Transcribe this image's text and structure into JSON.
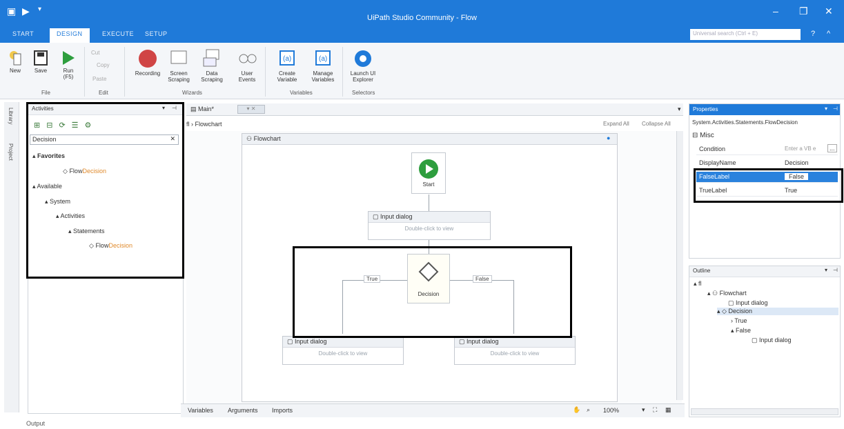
{
  "window": {
    "title": "UiPath Studio Community - Flow"
  },
  "ribbon_tabs": [
    "START",
    "DESIGN",
    "EXECUTE",
    "SETUP"
  ],
  "help_search_placeholder": "Universal search (Ctrl + E)",
  "ribbon": {
    "file": {
      "new": "New",
      "save": "Save",
      "run": "Run",
      "run_key": "(F5)",
      "group": "File"
    },
    "edit": {
      "cut": "Cut",
      "copy": "Copy",
      "paste": "Paste",
      "group": "Edit"
    },
    "wizards": {
      "recording": "Recording",
      "screen_scraping": "Screen Scraping",
      "data_scraping": "Data Scraping",
      "user_events": "User Events",
      "group": "Wizards"
    },
    "variables": {
      "create": "Create Variable",
      "manage": "Manage Variables",
      "group": "Variables"
    },
    "selectors": {
      "explorer": "Launch UI Explorer",
      "group": "Selectors"
    }
  },
  "left_rail": {
    "library": "Library",
    "project": "Project"
  },
  "activities": {
    "title": "Activities",
    "search_value": "Decision",
    "favorites": "Favorites",
    "fav_item_prefix": "Flow",
    "fav_item_hl": "Decision",
    "available": "Available",
    "system": "System",
    "acts": "Activities",
    "statements": "Statements",
    "item_prefix": "Flow",
    "item_hl": "Decision"
  },
  "designer": {
    "tab": "Main*",
    "breadcrumb": "Flowchart",
    "expand": "Expand All",
    "collapse": "Collapse All",
    "flowchart_title": "Flowchart",
    "start": "Start",
    "node1_title": "Input dialog",
    "node_body": "Double-click to view",
    "decision_label": "Decision",
    "true_label": "True",
    "false_label": "False",
    "node2_title": "Input dialog",
    "node3_title": "Input dialog"
  },
  "bottombar": {
    "variables": "Variables",
    "arguments": "Arguments",
    "imports": "Imports",
    "zoom": "100%"
  },
  "properties": {
    "title": "Properties",
    "type": "System.Activities.Statements.FlowDecision",
    "misc": "Misc",
    "rows": [
      {
        "name": "Condition",
        "value": "Enter a VB e"
      },
      {
        "name": "DisplayName",
        "value": "Decision"
      },
      {
        "name": "FalseLabel",
        "value": "False"
      },
      {
        "name": "TrueLabel",
        "value": "True"
      }
    ]
  },
  "outline": {
    "title": "Outline",
    "root": "Flowchart",
    "n1": "Input dialog",
    "n2": "Decision",
    "n3": "True",
    "n4": "False",
    "n5": "Input dialog"
  },
  "output": "Output"
}
